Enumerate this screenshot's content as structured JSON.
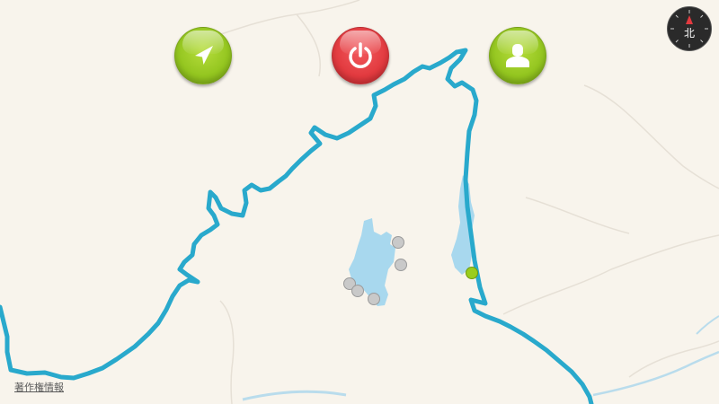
{
  "toolbar": {
    "navigate_icon": "navigation-arrow-icon",
    "power_icon": "power-icon",
    "user_icon": "user-profile-icon",
    "accent_green": "#93c51f",
    "accent_red": "#e23a3f"
  },
  "compass": {
    "label": "北",
    "icon": "compass-icon"
  },
  "map": {
    "copyright_link": "著作権情報",
    "route_color": "#29a9cc",
    "water_color": "#a8d8ee",
    "background_color": "#f8f4ec",
    "current_location_color": "#9acd1e"
  }
}
